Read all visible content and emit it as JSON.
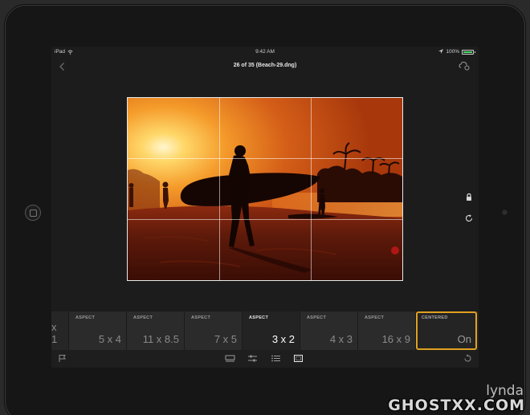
{
  "status_bar": {
    "device": "iPad",
    "time": "9:42 AM",
    "battery": "100%",
    "battery_level": 1.0
  },
  "nav": {
    "title": "26 of 35 (Beach-29.dng)"
  },
  "icons": {
    "back": "chevron-left-icon",
    "cloud": "cloud-sync-icon",
    "lock": "lock-icon",
    "rotate": "rotate-icon",
    "flag": "flag-icon",
    "undo": "undo-icon"
  },
  "aspect_bar": {
    "items": [
      {
        "category": "",
        "value": "x 1"
      },
      {
        "category": "ASPECT",
        "value": "5 x 4"
      },
      {
        "category": "ASPECT",
        "value": "11 x 8.5"
      },
      {
        "category": "ASPECT",
        "value": "7 x 5"
      },
      {
        "category": "ASPECT",
        "value": "3 x 2"
      },
      {
        "category": "ASPECT",
        "value": "4 x 3"
      },
      {
        "category": "ASPECT",
        "value": "16 x 9"
      },
      {
        "category": "CENTERED",
        "value": "On"
      }
    ],
    "selected_index": 4
  },
  "colors": {
    "accent": "#e0a020",
    "battery": "#4cd964"
  },
  "watermark": {
    "top": "lynda",
    "bottom": "GHOSTXX.COM"
  }
}
